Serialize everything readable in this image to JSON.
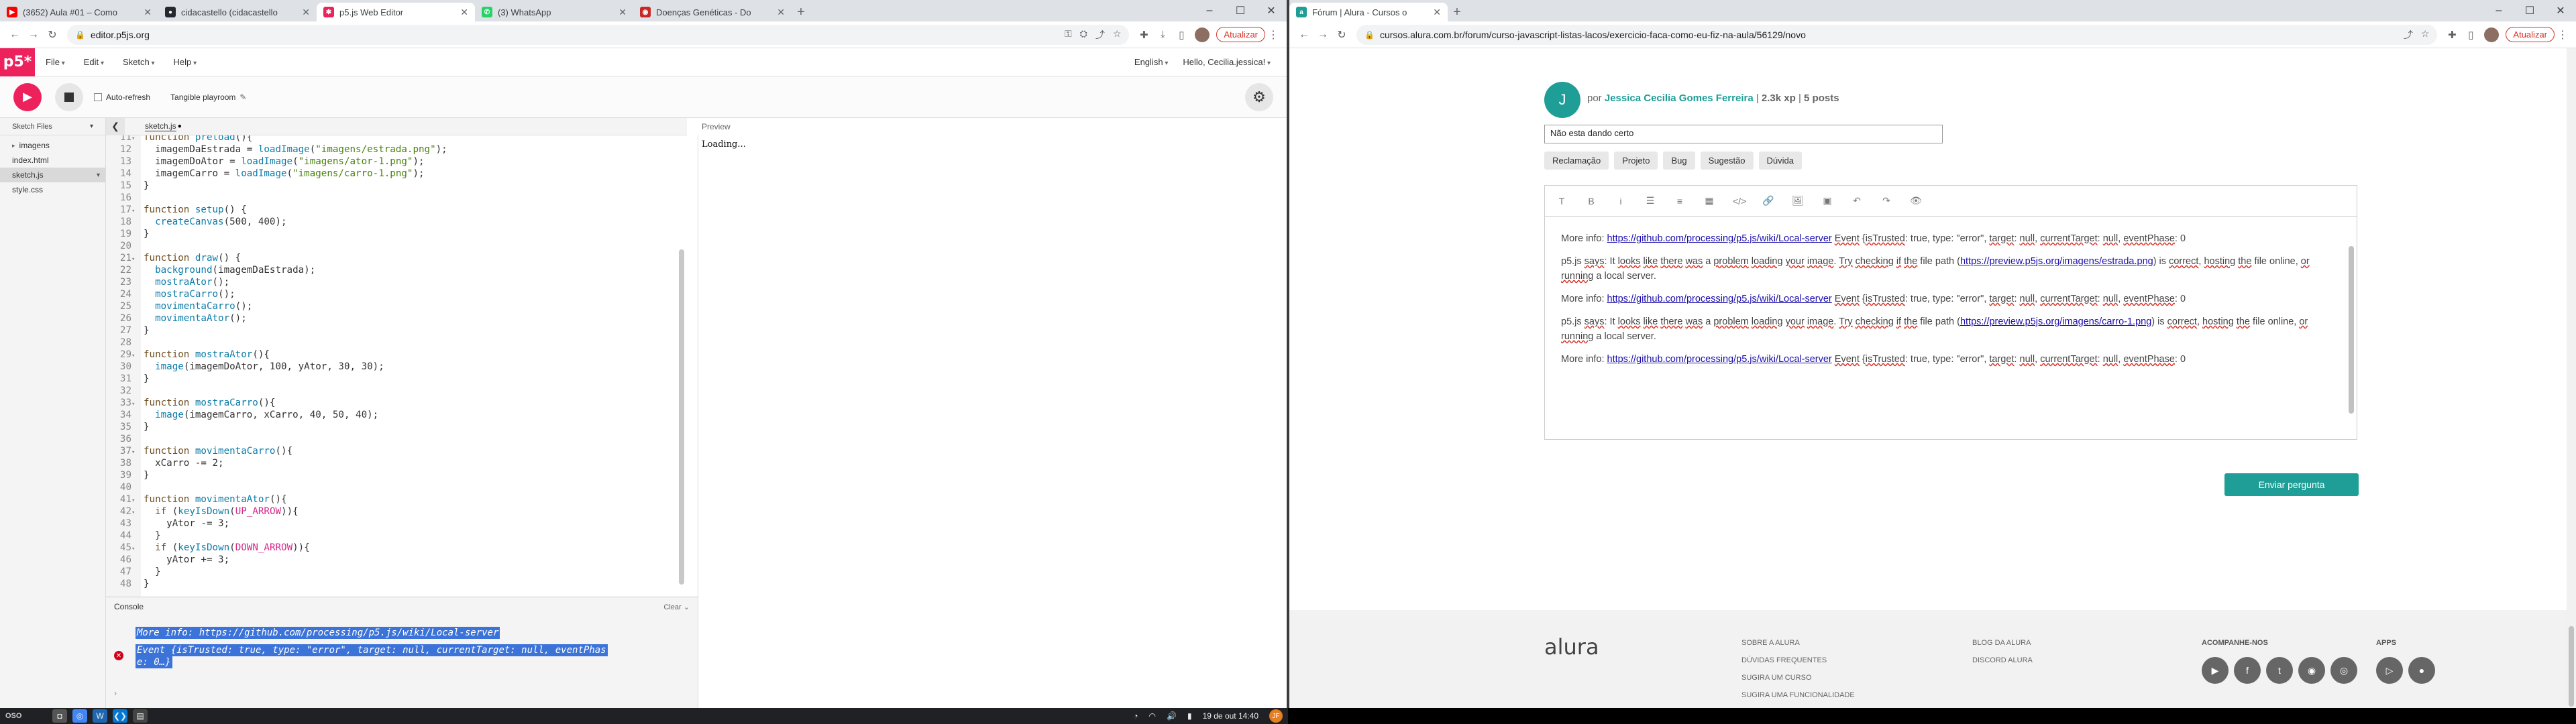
{
  "left_browser": {
    "tabs": [
      {
        "label": "(3652) Aula #01 – Como",
        "fav_color": "#ff0000",
        "fav_glyph": "▶"
      },
      {
        "label": "cidacastello (cidacastello",
        "fav_color": "#24292f",
        "fav_glyph": "●"
      },
      {
        "label": "p5.js Web Editor",
        "fav_color": "#ed225d",
        "fav_glyph": "✱"
      },
      {
        "label": "(3) WhatsApp",
        "fav_color": "#25d366",
        "fav_glyph": "✆"
      },
      {
        "label": "Doenças Genéticas - Do",
        "fav_color": "#c62828",
        "fav_glyph": "◉"
      }
    ],
    "url": "editor.p5js.org",
    "update_label": "Atualizar"
  },
  "p5": {
    "logo": "p5*",
    "menu": [
      "File",
      "Edit",
      "Sketch",
      "Help"
    ],
    "language": "English",
    "user": "Hello, Cecilia.jessica!",
    "auto_refresh": "Auto-refresh",
    "project_name": "Tangible playroom",
    "sidebar_title": "Sketch Files",
    "files": [
      {
        "name": "imagens",
        "type": "folder"
      },
      {
        "name": "index.html",
        "type": "file"
      },
      {
        "name": "sketch.js",
        "type": "file",
        "selected": true
      },
      {
        "name": "style.css",
        "type": "file"
      }
    ],
    "open_file": "sketch.js",
    "preview_label": "Preview",
    "preview_status": "Loading...",
    "console_title": "Console",
    "console_clear": "Clear",
    "console_lines": [
      "More info: https://github.com/processing/p5.js/wiki/Local-server",
      "Event {isTrusted: true, type: \"error\", target: null, currentTarget: null, eventPhas",
      "e: 0…}"
    ],
    "code": [
      {
        "n": "11",
        "fold": "▾",
        "html": "<span class='kw'>function</span> <span class='fn'>preload</span>(){"
      },
      {
        "n": "12",
        "fold": "",
        "html": "  imagemDaEstrada = <span class='fn'>loadImage</span>(<span class='str'>\"imagens/estrada.png\"</span>);"
      },
      {
        "n": "13",
        "fold": "",
        "html": "  imagemDoAtor = <span class='fn'>loadImage</span>(<span class='str'>\"imagens/ator-1.png\"</span>);"
      },
      {
        "n": "14",
        "fold": "",
        "html": "  imagemCarro = <span class='fn'>loadImage</span>(<span class='str'>\"imagens/carro-1.png\"</span>);"
      },
      {
        "n": "15",
        "fold": "",
        "html": "}"
      },
      {
        "n": "16",
        "fold": "",
        "html": ""
      },
      {
        "n": "17",
        "fold": "▾",
        "html": "<span class='kw'>function</span> <span class='fn'>setup</span>() {"
      },
      {
        "n": "18",
        "fold": "",
        "html": "  <span class='fn'>createCanvas</span>(500, 400);"
      },
      {
        "n": "19",
        "fold": "",
        "html": "}"
      },
      {
        "n": "20",
        "fold": "",
        "html": ""
      },
      {
        "n": "21",
        "fold": "▾",
        "html": "<span class='kw'>function</span> <span class='fn'>draw</span>() {"
      },
      {
        "n": "22",
        "fold": "",
        "html": "  <span class='fn'>background</span>(imagemDaEstrada);"
      },
      {
        "n": "23",
        "fold": "",
        "html": "  <span class='fn'>mostraAtor</span>();"
      },
      {
        "n": "24",
        "fold": "",
        "html": "  <span class='fn'>mostraCarro</span>();"
      },
      {
        "n": "25",
        "fold": "",
        "html": "  <span class='fn'>movimentaCarro</span>();"
      },
      {
        "n": "26",
        "fold": "",
        "html": "  <span class='fn'>movimentaAtor</span>();"
      },
      {
        "n": "27",
        "fold": "",
        "html": "}"
      },
      {
        "n": "28",
        "fold": "",
        "html": ""
      },
      {
        "n": "29",
        "fold": "▾",
        "html": "<span class='kw'>function</span> <span class='fn'>mostraAtor</span>(){"
      },
      {
        "n": "30",
        "fold": "",
        "html": "  <span class='fn'>image</span>(imagemDoAtor, 100, yAtor, 30, 30);"
      },
      {
        "n": "31",
        "fold": "",
        "html": "}"
      },
      {
        "n": "32",
        "fold": "",
        "html": ""
      },
      {
        "n": "33",
        "fold": "▾",
        "html": "<span class='kw'>function</span> <span class='fn'>mostraCarro</span>(){"
      },
      {
        "n": "34",
        "fold": "",
        "html": "  <span class='fn'>image</span>(imagemCarro, xCarro, 40, 50, 40);"
      },
      {
        "n": "35",
        "fold": "",
        "html": "}"
      },
      {
        "n": "36",
        "fold": "",
        "html": ""
      },
      {
        "n": "37",
        "fold": "▾",
        "html": "<span class='kw'>function</span> <span class='fn'>movimentaCarro</span>(){"
      },
      {
        "n": "38",
        "fold": "",
        "html": "  xCarro -= 2;"
      },
      {
        "n": "39",
        "fold": "",
        "html": "}"
      },
      {
        "n": "40",
        "fold": "",
        "html": ""
      },
      {
        "n": "41",
        "fold": "▾",
        "html": "<span class='kw'>function</span> <span class='fn'>movimentaAtor</span>(){"
      },
      {
        "n": "42",
        "fold": "▾",
        "html": "  <span class='kw'>if</span> (<span class='fn'>keyIsDown</span>(<span class='const'>UP_ARROW</span>)){"
      },
      {
        "n": "43",
        "fold": "",
        "html": "    yAtor -= 3;"
      },
      {
        "n": "44",
        "fold": "",
        "html": "  }"
      },
      {
        "n": "45",
        "fold": "▾",
        "html": "  <span class='kw'>if</span> (<span class='fn'>keyIsDown</span>(<span class='const'>DOWN_ARROW</span>)){"
      },
      {
        "n": "46",
        "fold": "",
        "html": "    yAtor += 3;"
      },
      {
        "n": "47",
        "fold": "",
        "html": "  }"
      },
      {
        "n": "48",
        "fold": "",
        "html": "}"
      }
    ]
  },
  "right_browser": {
    "tabs": [
      {
        "label": "Fórum | Alura - Cursos o",
        "fav_color": "#1e9e96",
        "fav_glyph": "a"
      }
    ],
    "url": "cursos.alura.com.br/forum/curso-javascript-listas-lacos/exercicio-faca-como-eu-fiz-na-aula/56129/novo",
    "update_label": "Atualizar"
  },
  "forum": {
    "avatar_letter": "J",
    "author_prefix": "por",
    "author_name": "Jessica Cecilia Gomes Ferreira",
    "author_xp": "2.3k xp",
    "author_posts": "5 posts",
    "title_value": "Não esta dando certo",
    "tags": [
      "Reclamação",
      "Projeto",
      "Bug",
      "Sugestão",
      "Dúvida"
    ],
    "editor_tools": [
      "T",
      "B",
      "i",
      "☰",
      "≡",
      "▦",
      "</>",
      "🔗",
      "🖼",
      "▣",
      "↶",
      "↷",
      "👁"
    ],
    "paragraphs": [
      "More info: <span class='lnk'>https://github.com/processing/p5.js/wiki/Local-server</span> <span class='u'>Event</span> {<span class='u'>isTrusted</span>: true, type: \"error\", <span class='u'>target</span>: <span class='u'>null</span>, <span class='u'>currentTarget</span>: <span class='u'>null</span>, <span class='u'>eventPhase</span>: 0",
      "p5.js <span class='u'>says</span>: It <span class='u'>looks</span> <span class='u'>like</span> <span class='u'>there</span> <span class='u'>was</span> a <span class='u'>problem</span> <span class='u'>loading</span> <span class='u'>your</span> <span class='u'>image</span>. <span class='u'>Try</span> <span class='u'>checking</span> <span class='u'>if</span> <span class='u'>the</span> file path (<span class='lnk'>https://preview.p5js.org/imagens/estrada.png</span>) is <span class='u'>correct</span>, <span class='u'>hosting</span> <span class='u'>the</span> file online, <span class='u'>or</span> <span class='u'>running</span> a local server.",
      "More info: <span class='lnk'>https://github.com/processing/p5.js/wiki/Local-server</span> <span class='u'>Event</span> {<span class='u'>isTrusted</span>: true, type: \"error\", <span class='u'>target</span>: <span class='u'>null</span>, <span class='u'>currentTarget</span>: <span class='u'>null</span>, <span class='u'>eventPhase</span>: 0",
      "p5.js <span class='u'>says</span>: It <span class='u'>looks</span> <span class='u'>like</span> <span class='u'>there</span> <span class='u'>was</span> a <span class='u'>problem</span> <span class='u'>loading</span> <span class='u'>your</span> <span class='u'>image</span>. <span class='u'>Try</span> <span class='u'>checking</span> <span class='u'>if</span> <span class='u'>the</span> file path (<span class='lnk'>https://preview.p5js.org/imagens/carro-1.png</span>) is <span class='u'>correct</span>, <span class='u'>hosting</span> <span class='u'>the</span> file online, <span class='u'>or</span> <span class='u'>running</span> a local server.",
      "More info: <span class='lnk'>https://github.com/processing/p5.js/wiki/Local-server</span> <span class='u'>Event</span> {<span class='u'>isTrusted</span>: true, type: \"error\", <span class='u'>target</span>: <span class='u'>null</span>, <span class='u'>currentTarget</span>: <span class='u'>null</span>, <span class='u'>eventPhase</span>: 0"
    ],
    "send_label": "Enviar pergunta",
    "footer": {
      "logo": "alura",
      "col1": [
        "SOBRE A ALURA",
        "DÚVIDAS FREQUENTES",
        "SUGIRA UM CURSO",
        "SUGIRA UMA FUNCIONALIDADE"
      ],
      "col2": [
        "BLOG DA ALURA",
        "DISCORD ALURA"
      ],
      "social_title": "ACOMPANHE-NOS",
      "apps_title": "APPS"
    }
  },
  "taskbar": {
    "os_label": "OSO",
    "datetime": "19 de out  14:40",
    "user_initials": "JF"
  }
}
